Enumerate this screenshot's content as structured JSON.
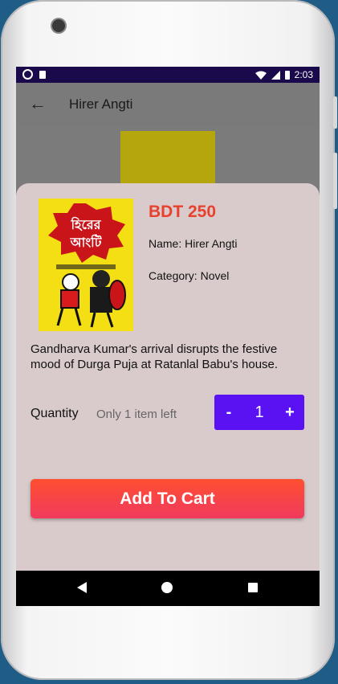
{
  "status_bar": {
    "time": "2:03"
  },
  "app_bar": {
    "title": "Hirer Angti"
  },
  "product": {
    "cover_title_line1": "হিরের",
    "cover_title_line2": "আংটি",
    "price": "BDT 250",
    "name": "Name: Hirer Angti",
    "category": "Category: Novel",
    "description": "Gandharva Kumar's arrival disrupts the festive mood of Durga Puja at Ratanlal Babu's house."
  },
  "quantity": {
    "label": "Quantity",
    "note": "Only 1 item left",
    "minus": "-",
    "value": "1",
    "plus": "+"
  },
  "cart": {
    "button_label": "Add To Cart"
  },
  "colors": {
    "accent": "#5a12f2",
    "price": "#e8412e",
    "cart_start": "#ff4f30",
    "cart_end": "#f03a5e",
    "status_bar": "#1a0a4c"
  }
}
